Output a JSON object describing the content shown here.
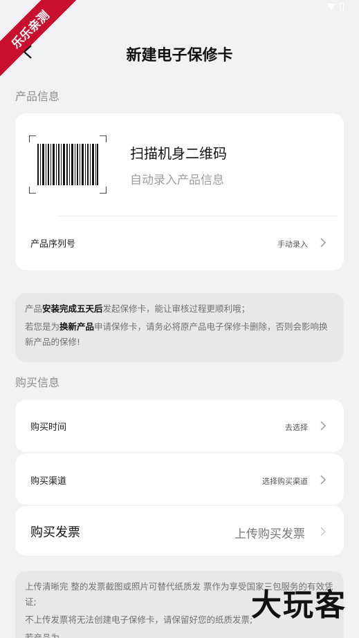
{
  "nav": {
    "title": "新建电子保修卡"
  },
  "badge": {
    "ribbon_text": "乐乐亲测"
  },
  "product_info": {
    "section_label": "产品信息",
    "scan_title": "扫描机身二维码",
    "scan_subtitle": "自动录入产品信息",
    "serial_label": "产品序列号",
    "serial_action": "手动录入"
  },
  "note1": {
    "line1_a": "产品",
    "line1_b": "安装完成五天后",
    "line1_c": "发起保修卡，能让审核过程更顺利哦；",
    "line2_a": "若您是为",
    "line2_b": "换新产品",
    "line2_c": "申请保修卡，请务必将原产品电子保修卡删除，否则会影响换新产品的保修!"
  },
  "purchase_info": {
    "section_label": "购买信息",
    "time_label": "购买时间",
    "time_action": "去选择",
    "channel_label": "购买渠道",
    "channel_action": "选择购买渠道",
    "invoice_label": "购买发票",
    "invoice_action": "上传购买发票"
  },
  "note2": {
    "line1": "上传清晰完 整的发票截图或照片可替代纸质发 票作为享受国家三包服务的有效凭证;",
    "line2": "不上传发票将无法创建电子保修卡，请保留好您的纸质发票;",
    "line3": "若产品为"
  },
  "watermark": {
    "text": "大玩客"
  },
  "colors": {
    "background": "#f1f2f5",
    "card": "#ffffff",
    "ribbon": "#c8102e",
    "muted": "#8b8f96"
  }
}
